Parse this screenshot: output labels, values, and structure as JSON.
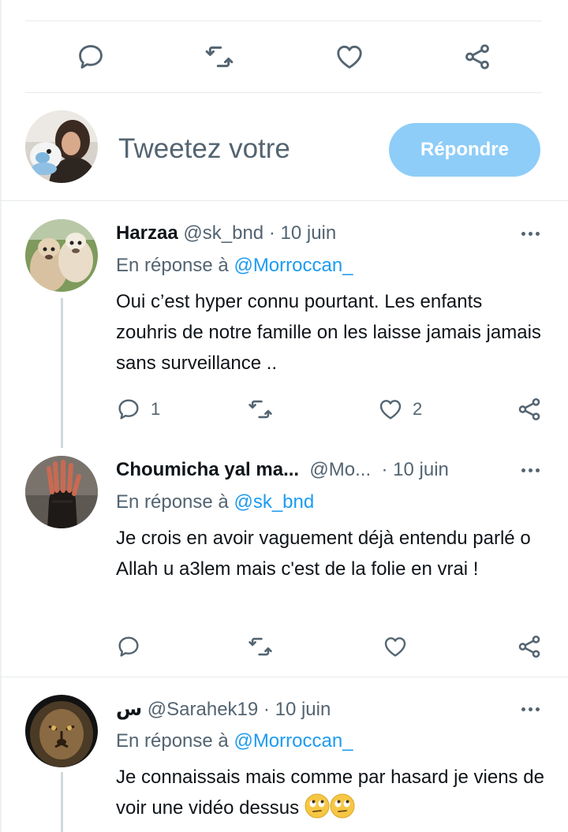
{
  "top_actions": {
    "icons": [
      "reply-icon",
      "retweet-icon",
      "like-icon",
      "share-icon"
    ]
  },
  "compose": {
    "placeholder": "Tweetez votre",
    "reply_button": "Répondre"
  },
  "tweets": [
    {
      "name": "Harzaa",
      "handle": "@sk_bnd",
      "separator": "·",
      "date": "10 juin",
      "reply_prefix": "En réponse à",
      "reply_to": "@Morroccan_",
      "text": "Oui c’est hyper connu pourtant. Les enfants zouhris de notre famille on les laisse jamais jamais sans surveillance ..",
      "replies": "1",
      "retweets": "",
      "likes": "2"
    },
    {
      "name": "Choumicha yal ma...",
      "handle": "@Mo...",
      "separator": "·",
      "date": "10 juin",
      "reply_prefix": "En réponse à",
      "reply_to": "@sk_bnd",
      "text": "Je crois en avoir vaguement déjà entendu parlé o Allah u a3lem mais c'est de la folie en vrai !",
      "replies": "",
      "retweets": "",
      "likes": ""
    },
    {
      "name": "س",
      "handle": "@Sarahek19",
      "separator": "·",
      "date": "10 juin",
      "reply_prefix": "En réponse à",
      "reply_to": "@Morroccan_",
      "text": "Je connaissais mais comme par hasard je viens de voir une vidéo dessus",
      "emoji": "face-with-rolling-eyes-icon ×2"
    }
  ],
  "colors": {
    "accent": "#1d9bf0",
    "reply_button": "#8ecdf8",
    "secondary_text": "#536471",
    "divider": "#e7eaed"
  }
}
